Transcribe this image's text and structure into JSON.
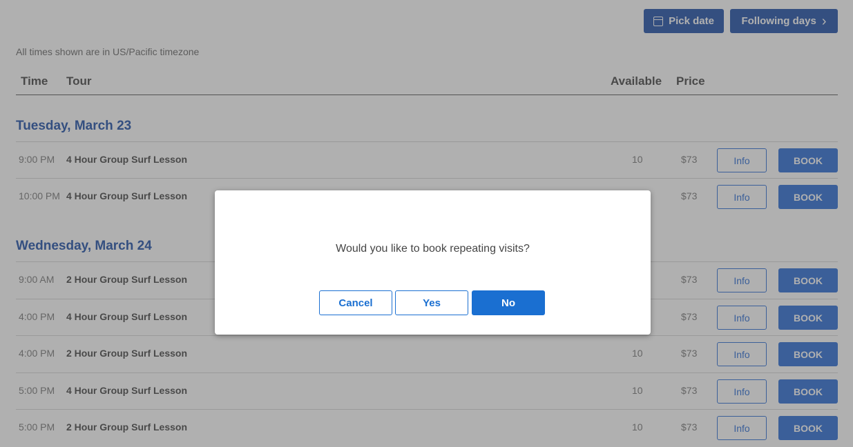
{
  "toolbar": {
    "pick_date_label": "Pick date",
    "following_days_label": "Following days",
    "accent_color": "#1e4fa8"
  },
  "timezone_note": "All times shown are in US/Pacific timezone",
  "table_headers": {
    "time": "Time",
    "tour": "Tour",
    "available": "Available",
    "price": "Price"
  },
  "days": [
    {
      "heading": "Tuesday, March 23",
      "rows": [
        {
          "time": "9:00 PM",
          "tour": "4 Hour Group Surf Lesson",
          "available": "10",
          "price": "$73",
          "info": "Info",
          "book": "BOOK"
        },
        {
          "time": "10:00 PM",
          "tour": "4 Hour Group Surf Lesson",
          "available": "",
          "price": "$73",
          "info": "Info",
          "book": "BOOK"
        }
      ]
    },
    {
      "heading": "Wednesday, March 24",
      "rows": [
        {
          "time": "9:00 AM",
          "tour": "2 Hour Group Surf Lesson",
          "available": "",
          "price": "$73",
          "info": "Info",
          "book": "BOOK"
        },
        {
          "time": "4:00 PM",
          "tour": "4 Hour Group Surf Lesson",
          "available": "",
          "price": "$73",
          "info": "Info",
          "book": "BOOK"
        },
        {
          "time": "4:00 PM",
          "tour": "2 Hour Group Surf Lesson",
          "available": "10",
          "price": "$73",
          "info": "Info",
          "book": "BOOK"
        },
        {
          "time": "5:00 PM",
          "tour": "4 Hour Group Surf Lesson",
          "available": "10",
          "price": "$73",
          "info": "Info",
          "book": "BOOK"
        },
        {
          "time": "5:00 PM",
          "tour": "2 Hour Group Surf Lesson",
          "available": "10",
          "price": "$73",
          "info": "Info",
          "book": "BOOK"
        }
      ]
    }
  ],
  "modal": {
    "message": "Would you like to book repeating visits?",
    "cancel_label": "Cancel",
    "yes_label": "Yes",
    "no_label": "No"
  }
}
